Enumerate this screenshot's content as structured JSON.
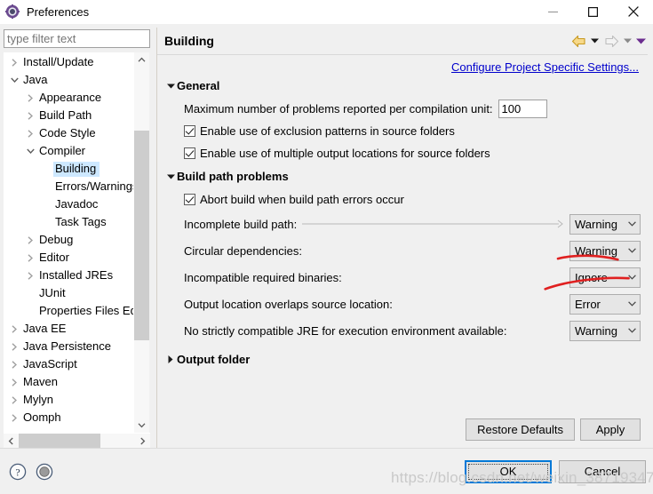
{
  "window": {
    "title": "Preferences",
    "icon": "preferences-gear-icon",
    "minimize_label": "Minimize",
    "maximize_label": "Maximize",
    "close_label": "Close"
  },
  "filter": {
    "placeholder": "type filter text",
    "value": ""
  },
  "tree": {
    "items": [
      {
        "label": "Install/Update",
        "indent": 0,
        "twisty": "collapsed",
        "selected": false
      },
      {
        "label": "Java",
        "indent": 0,
        "twisty": "expanded",
        "selected": false
      },
      {
        "label": "Appearance",
        "indent": 1,
        "twisty": "collapsed",
        "selected": false
      },
      {
        "label": "Build Path",
        "indent": 1,
        "twisty": "collapsed",
        "selected": false
      },
      {
        "label": "Code Style",
        "indent": 1,
        "twisty": "collapsed",
        "selected": false
      },
      {
        "label": "Compiler",
        "indent": 1,
        "twisty": "expanded",
        "selected": false
      },
      {
        "label": "Building",
        "indent": 2,
        "twisty": "none",
        "selected": true
      },
      {
        "label": "Errors/Warnings",
        "indent": 2,
        "twisty": "none",
        "selected": false
      },
      {
        "label": "Javadoc",
        "indent": 2,
        "twisty": "none",
        "selected": false
      },
      {
        "label": "Task Tags",
        "indent": 2,
        "twisty": "none",
        "selected": false
      },
      {
        "label": "Debug",
        "indent": 1,
        "twisty": "collapsed",
        "selected": false
      },
      {
        "label": "Editor",
        "indent": 1,
        "twisty": "collapsed",
        "selected": false
      },
      {
        "label": "Installed JREs",
        "indent": 1,
        "twisty": "collapsed",
        "selected": false
      },
      {
        "label": "JUnit",
        "indent": 1,
        "twisty": "none",
        "selected": false
      },
      {
        "label": "Properties Files Editor",
        "indent": 1,
        "twisty": "none",
        "selected": false
      },
      {
        "label": "Java EE",
        "indent": 0,
        "twisty": "collapsed",
        "selected": false
      },
      {
        "label": "Java Persistence",
        "indent": 0,
        "twisty": "collapsed",
        "selected": false
      },
      {
        "label": "JavaScript",
        "indent": 0,
        "twisty": "collapsed",
        "selected": false
      },
      {
        "label": "Maven",
        "indent": 0,
        "twisty": "collapsed",
        "selected": false
      },
      {
        "label": "Mylyn",
        "indent": 0,
        "twisty": "collapsed",
        "selected": false
      },
      {
        "label": "Oomph",
        "indent": 0,
        "twisty": "collapsed",
        "selected": false
      }
    ]
  },
  "pane": {
    "title": "Building",
    "nav": {
      "back": "back-arrow-icon",
      "back_menu": "back-dropdown-icon",
      "forward": "forward-arrow-icon",
      "forward_menu": "forward-dropdown-icon",
      "view_menu": "view-menu-icon"
    },
    "configure_link": "Configure Project Specific Settings...",
    "general": {
      "heading": "General",
      "max_problems_label": "Maximum number of problems reported per compilation unit:",
      "max_problems_value": "100",
      "checkboxes": [
        {
          "label": "Enable use of exclusion patterns in source folders",
          "checked": true
        },
        {
          "label": "Enable use of multiple output locations for source folders",
          "checked": true
        }
      ]
    },
    "build_path_problems": {
      "heading": "Build path problems",
      "abort_checkbox": {
        "label": "Abort build when build path errors occur",
        "checked": true
      },
      "rows": [
        {
          "label": "Incomplete build path:",
          "value": "Warning",
          "leader": true
        },
        {
          "label": "Circular dependencies:",
          "value": "Warning",
          "leader": false
        },
        {
          "label": "Incompatible required binaries:",
          "value": "Ignore",
          "leader": false
        },
        {
          "label": "Output location overlaps source location:",
          "value": "Error",
          "leader": false
        },
        {
          "label": "No strictly compatible JRE for execution environment available:",
          "value": "Warning",
          "leader": false
        }
      ]
    },
    "output_folder": {
      "heading": "Output folder",
      "state": "collapsed"
    },
    "restore_defaults_label": "Restore Defaults",
    "apply_label": "Apply"
  },
  "footer": {
    "help_icon": "help-question-icon",
    "secondary_icon": "shell-circle-icon",
    "ok_label": "OK",
    "cancel_label": "Cancel"
  },
  "watermark": "https://blog.csdn.net/weixin_38719347",
  "colors": {
    "accent": "#0078d7",
    "link": "#0000cc",
    "selection": "#cde8ff",
    "annotation_red": "#e02020",
    "back_arrow": "#e8b84b",
    "menu_purple": "#6b2d8f"
  }
}
